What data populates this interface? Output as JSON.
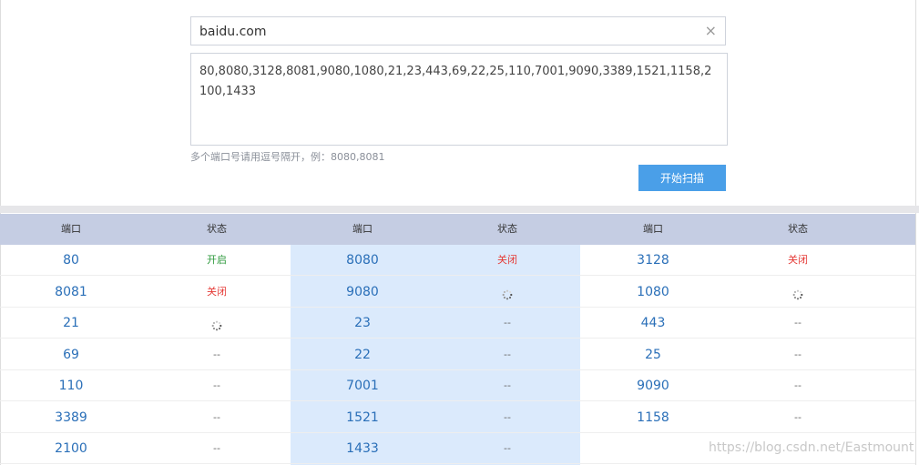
{
  "scan_form": {
    "host_value": "baidu.com",
    "clear_icon": "×",
    "ports_value": "80,8080,3128,8081,9080,1080,21,23,443,69,22,25,110,7001,9090,3389,1521,1158,2100,1433",
    "hint": "多个端口号请用逗号隔开，例：8080,8081",
    "scan_button": "开始扫描"
  },
  "table": {
    "headers": [
      "端口",
      "状态",
      "端口",
      "状态",
      "端口",
      "状态"
    ],
    "rows": [
      [
        {
          "port": "80",
          "status": "开启",
          "state": "open"
        },
        {
          "port": "8080",
          "status": "关闭",
          "state": "closed"
        },
        {
          "port": "3128",
          "status": "关闭",
          "state": "closed"
        }
      ],
      [
        {
          "port": "8081",
          "status": "关闭",
          "state": "closed"
        },
        {
          "port": "9080",
          "status": "",
          "state": "loading"
        },
        {
          "port": "1080",
          "status": "",
          "state": "loading"
        }
      ],
      [
        {
          "port": "21",
          "status": "",
          "state": "loading"
        },
        {
          "port": "23",
          "status": "--",
          "state": "pending"
        },
        {
          "port": "443",
          "status": "--",
          "state": "pending"
        }
      ],
      [
        {
          "port": "69",
          "status": "--",
          "state": "pending"
        },
        {
          "port": "22",
          "status": "--",
          "state": "pending"
        },
        {
          "port": "25",
          "status": "--",
          "state": "pending"
        }
      ],
      [
        {
          "port": "110",
          "status": "--",
          "state": "pending"
        },
        {
          "port": "7001",
          "status": "--",
          "state": "pending"
        },
        {
          "port": "9090",
          "status": "--",
          "state": "pending"
        }
      ],
      [
        {
          "port": "3389",
          "status": "--",
          "state": "pending"
        },
        {
          "port": "1521",
          "status": "--",
          "state": "pending"
        },
        {
          "port": "1158",
          "status": "--",
          "state": "pending"
        }
      ],
      [
        {
          "port": "2100",
          "status": "--",
          "state": "pending"
        },
        {
          "port": "1433",
          "status": "--",
          "state": "pending"
        },
        {
          "port": "",
          "status": "",
          "state": "empty"
        }
      ]
    ]
  },
  "watermark": "https://blog.csdn.net/Eastmount",
  "colors": {
    "open": "#2e9a3d",
    "closed": "#e53935",
    "port": "#2a6fb8",
    "header_bg": "#c5cde3",
    "highlight_col": "#dbeafc",
    "button": "#4a9fe8"
  }
}
